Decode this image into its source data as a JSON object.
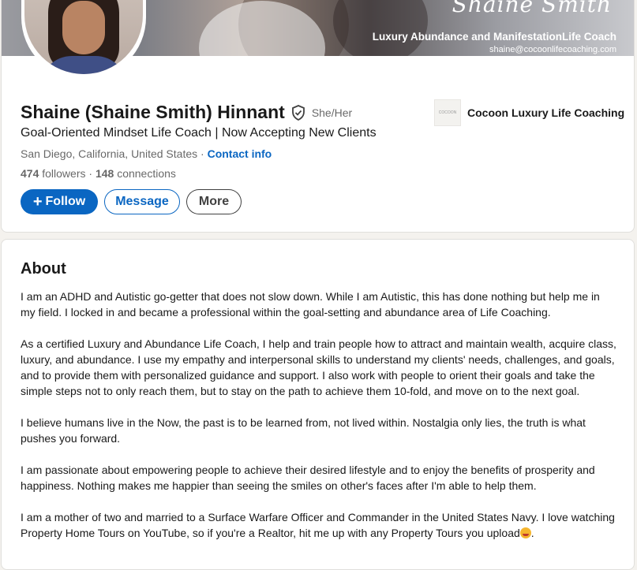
{
  "banner": {
    "script_name": "Shaine Smith",
    "tagline": "Luxury Abundance and ManifestationLife Coach",
    "email": "shaine@cocoonlifecoaching.com"
  },
  "profile": {
    "name": "Shaine (Shaine Smith) Hinnant",
    "pronouns": "She/Her",
    "headline": "Goal-Oriented Mindset Life Coach | Now Accepting New Clients",
    "location": "San Diego, California, United States",
    "location_separator": " · ",
    "contact_label": "Contact info",
    "followers_count": "474",
    "followers_label": " followers",
    "stats_separator": " · ",
    "connections_count": "148",
    "connections_label": " connections"
  },
  "company": {
    "name": "Cocoon Luxury Life Coaching",
    "logo_text": "COCOON"
  },
  "actions": {
    "follow_plus": "+",
    "follow_label": "Follow",
    "message_label": "Message",
    "more_label": "More"
  },
  "about": {
    "title": "About",
    "paragraphs": [
      "I am an ADHD and Autistic go-getter that does not slow down. While I am Autistic, this has done nothing but help me in my field. I locked in and became a professional within the goal-setting and abundance area of Life Coaching.",
      "As a certified Luxury and Abundance Life Coach, I help and train people how to attract and maintain wealth, acquire class, luxury, and abundance. I use my empathy and interpersonal skills to understand my clients' needs, challenges, and goals, and to provide them with personalized guidance and support. I also work with people to orient their goals and take the simple steps not to only reach them, but to stay on the path to achieve them 10-fold, and move on to the next goal.",
      "I believe humans live in the Now, the past is to be learned from, not lived within. Nostalgia only lies, the truth is what pushes you forward.",
      "I am passionate about empowering people to achieve their desired lifestyle and to enjoy the benefits of prosperity and happiness. Nothing makes me happier than seeing the smiles on other's faces after I'm able to help them.",
      "I am a mother of two and married to a Surface Warfare Officer and Commander in the United States Navy. I love watching Property Home Tours on YouTube, so if you're a Realtor, hit me up with any Property Tours you upload"
    ],
    "last_suffix": ".",
    "emoji_icon": "smiling-face-with-hearts-icon"
  },
  "colors": {
    "accent": "#0a66c2",
    "page_bg": "#f4f2ee"
  }
}
